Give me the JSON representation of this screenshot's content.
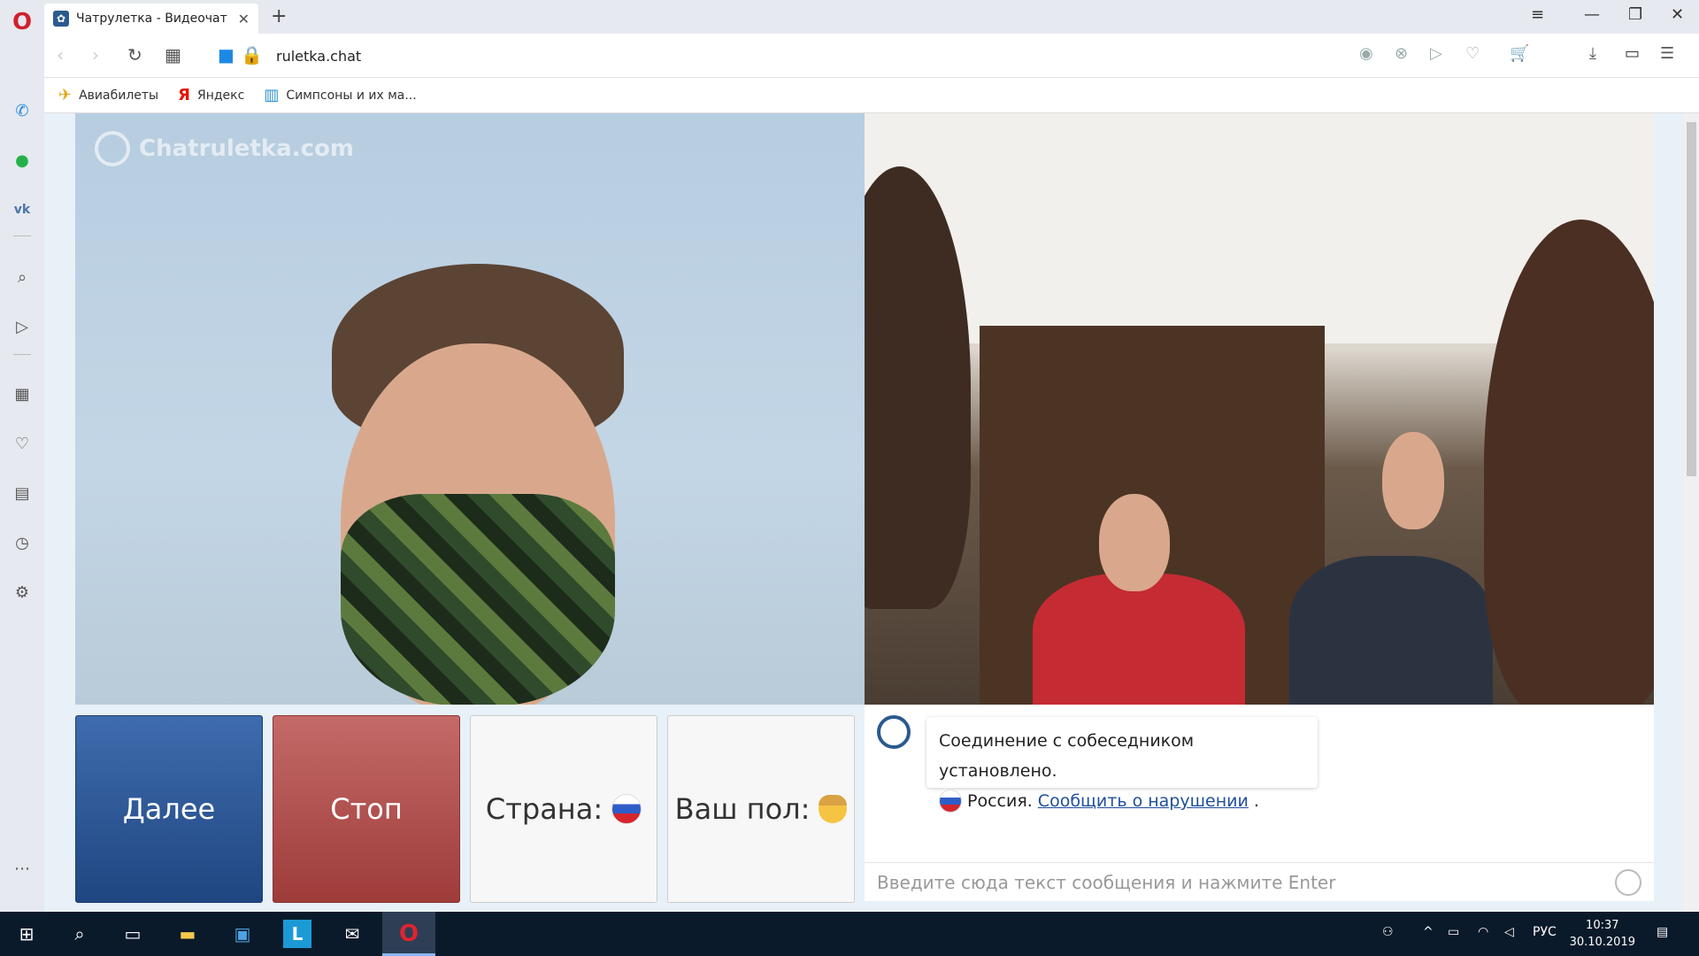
{
  "browser": {
    "tab_title": "Чатрулетка - Видеочат №",
    "url": "ruletka.chat",
    "bookmarks": [
      {
        "label": "Авиабилеты"
      },
      {
        "label": "Яндекс"
      },
      {
        "label": "Симпсоны и их ма..."
      }
    ]
  },
  "video": {
    "watermark": "Chatruletka.com"
  },
  "controls": {
    "next_label": "Далее",
    "stop_label": "Стоп",
    "country_label": "Страна:",
    "gender_label": "Ваш пол:"
  },
  "chat": {
    "status_message": "Соединение с собеседником установлено.",
    "country": "Россия.",
    "report_link": "Сообщить о нарушении",
    "trailing": ".",
    "input_placeholder": "Введите сюда текст сообщения и нажмите Enter"
  },
  "taskbar": {
    "language": "РУС",
    "time": "10:37",
    "date": "30.10.2019"
  },
  "colors": {
    "next_button": "#2a5699",
    "stop_button": "#b04e4c",
    "page_bg": "#e8f1f8",
    "link": "#1f4f9a"
  }
}
